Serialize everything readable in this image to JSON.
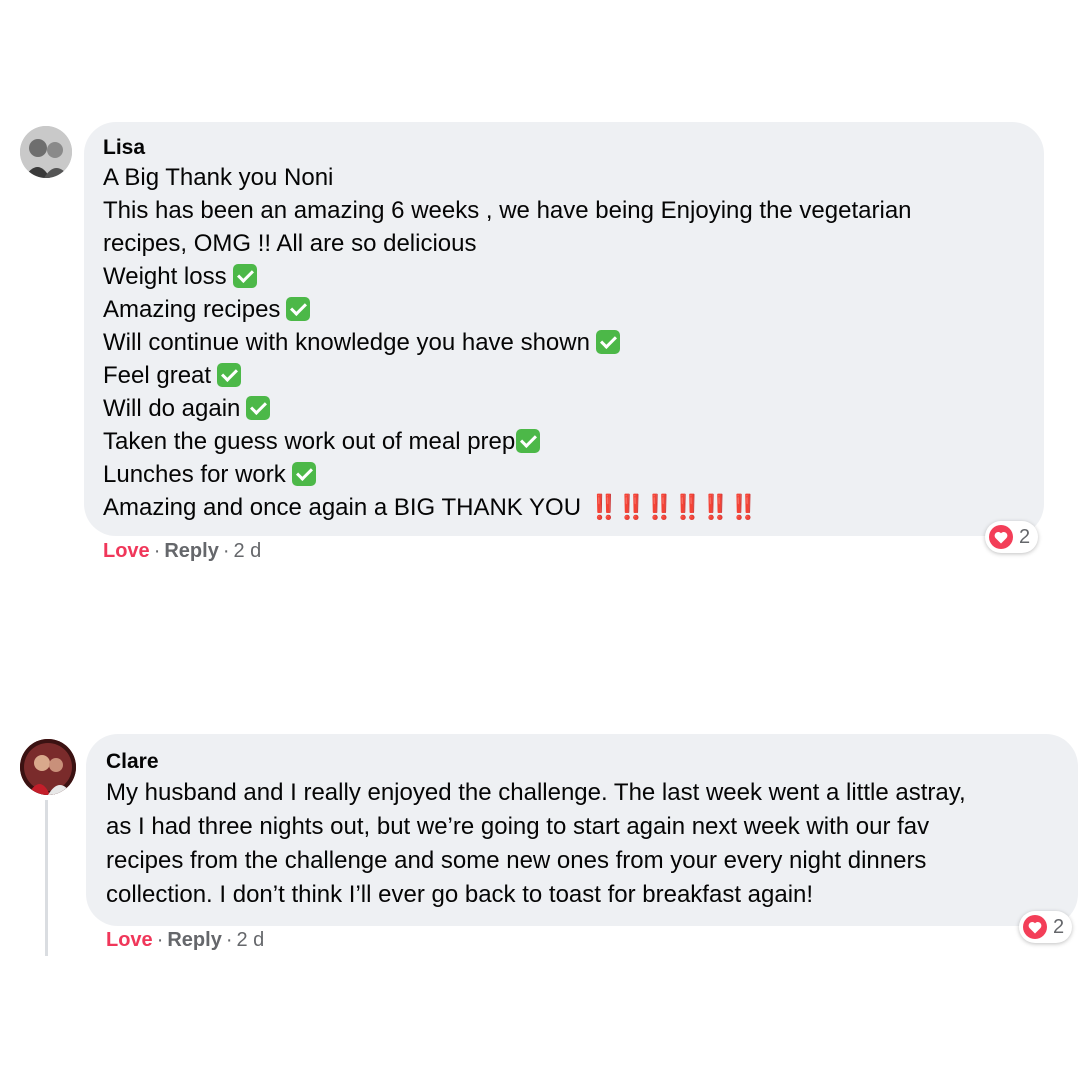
{
  "comments": [
    {
      "author": "Lisa",
      "lines": [
        {
          "text": "A Big Thank you Noni"
        },
        {
          "text": "This has been an amazing 6 weeks , we have being Enjoying the vegetarian"
        },
        {
          "text": "recipes, OMG !! All are so delicious"
        },
        {
          "text": "Weight loss"
        },
        {
          "text": "Amazing recipes"
        },
        {
          "text": "Will continue with knowledge you have shown"
        },
        {
          "text": "Feel great"
        },
        {
          "text": "Will do again"
        },
        {
          "text": "Taken the guess work out of meal prep"
        },
        {
          "text": "Lunches for work"
        },
        {
          "text": "Amazing and once again a BIG THANK YOU",
          "suffix": "‼️‼️‼️‼️‼️‼️"
        }
      ],
      "actions": {
        "love": "Love",
        "reply": "Reply",
        "time": "2 d"
      },
      "reaction_count": "2"
    },
    {
      "author": "Clare",
      "lines": [
        {
          "text": "My husband and I really enjoyed the challenge. The last week went a little astray,"
        },
        {
          "text": "as I had three nights out, but we’re going to start again next week with our fav"
        },
        {
          "text": "recipes from the challenge and some new ones from your every night dinners"
        },
        {
          "text": "collection. I don’t think I’ll ever go back to toast for breakfast again!"
        }
      ],
      "actions": {
        "love": "Love",
        "reply": "Reply",
        "time": "2 d"
      },
      "reaction_count": "2"
    }
  ],
  "icons": {
    "check": "check-mark-button-icon",
    "reaction": "heart-reaction-icon"
  },
  "colors": {
    "love": "#f0375a",
    "bubble": "#eef0f3",
    "check": "#4cb848",
    "heart": "#f33e58"
  }
}
